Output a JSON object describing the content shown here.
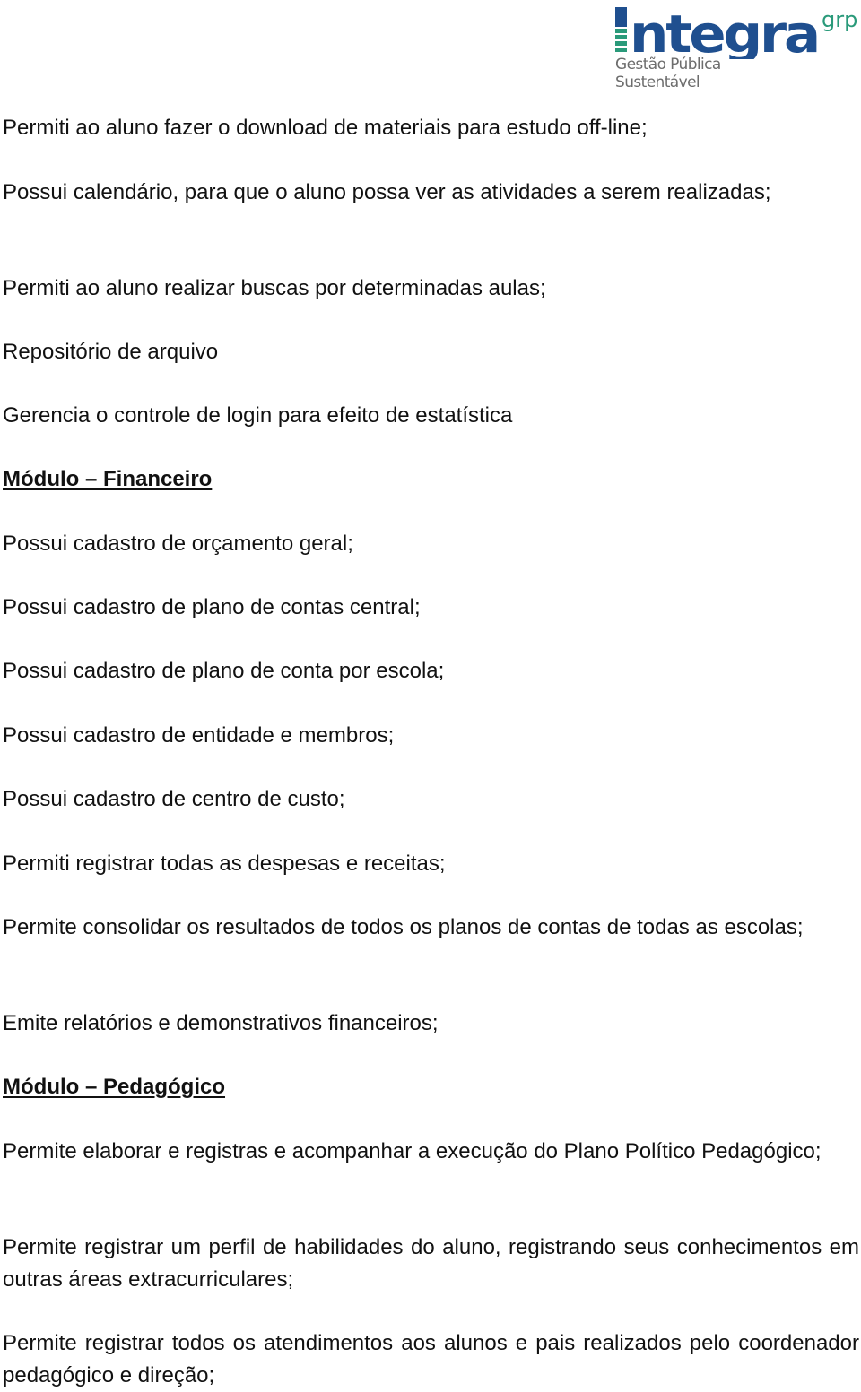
{
  "logo": {
    "brand": "Integra",
    "suffix": "grp",
    "tagline_line1": "Gestão Pública",
    "tagline_line2": "Sustentável",
    "colors": {
      "brand_blue": "#1f4f8f",
      "brand_green": "#2a9a7a",
      "tagline_gray": "#6d6d6d"
    }
  },
  "document": {
    "items": [
      {
        "type": "paragraph",
        "text": "Permiti ao aluno fazer o download de materiais para estudo off-line;"
      },
      {
        "type": "paragraph",
        "text": "Possui calendário, para que o aluno possa ver as atividades a serem realizadas;"
      },
      {
        "type": "paragraph",
        "text": "Permiti ao aluno realizar buscas por determinadas aulas;"
      },
      {
        "type": "paragraph",
        "text": "Repositório de arquivo"
      },
      {
        "type": "paragraph",
        "text": "Gerencia o controle de login para efeito de estatística"
      },
      {
        "type": "heading",
        "text": "Módulo – Financeiro"
      },
      {
        "type": "paragraph",
        "text": "Possui cadastro de orçamento geral;"
      },
      {
        "type": "paragraph",
        "text": "Possui cadastro de plano de contas central;"
      },
      {
        "type": "paragraph",
        "text": "Possui cadastro de plano de conta por escola;"
      },
      {
        "type": "paragraph",
        "text": "Possui cadastro de entidade e membros;"
      },
      {
        "type": "paragraph",
        "text": "Possui cadastro de centro de custo;"
      },
      {
        "type": "paragraph",
        "text": "Permiti registrar todas as despesas e receitas;"
      },
      {
        "type": "paragraph",
        "text": "Permite consolidar os resultados de todos os planos de contas de todas as escolas;"
      },
      {
        "type": "paragraph",
        "text": "Emite relatórios e demonstrativos financeiros;"
      },
      {
        "type": "heading",
        "text": "Módulo – Pedagógico"
      },
      {
        "type": "paragraph",
        "text": "Permite elaborar e registras e acompanhar a execução do Plano Político Pedagógico;"
      },
      {
        "type": "paragraph",
        "text": "Permite registrar um perfil de habilidades do aluno, registrando seus conhecimentos em outras áreas extracurriculares;"
      },
      {
        "type": "paragraph",
        "text": "Permite registrar todos os atendimentos aos alunos e pais realizados pelo coordenador pedagógico e direção;"
      }
    ]
  }
}
